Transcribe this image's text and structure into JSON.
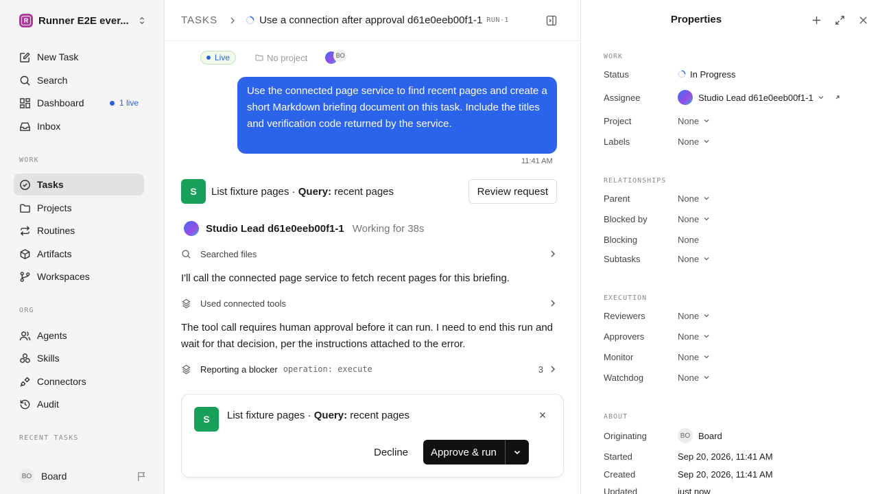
{
  "sidebar": {
    "workspace_name": "Runner E2E ever...",
    "workspace_initial": "R",
    "nav": [
      {
        "label": "New Task",
        "icon": "edit-icon"
      },
      {
        "label": "Search",
        "icon": "search-icon"
      },
      {
        "label": "Dashboard",
        "icon": "dashboard-icon",
        "badge": "1 live"
      },
      {
        "label": "Inbox",
        "icon": "inbox-icon"
      }
    ],
    "work_label": "WORK",
    "work": [
      {
        "label": "Tasks",
        "icon": "check-circle-icon",
        "active": true
      },
      {
        "label": "Projects",
        "icon": "folder-icon"
      },
      {
        "label": "Routines",
        "icon": "repeat-icon"
      },
      {
        "label": "Artifacts",
        "icon": "cube-icon"
      },
      {
        "label": "Workspaces",
        "icon": "branch-icon"
      }
    ],
    "org_label": "ORG",
    "org": [
      {
        "label": "Agents",
        "icon": "users-icon"
      },
      {
        "label": "Skills",
        "icon": "skills-icon"
      },
      {
        "label": "Connectors",
        "icon": "plug-icon"
      },
      {
        "label": "Audit",
        "icon": "history-icon"
      }
    ],
    "recent_label": "RECENT TASKS",
    "footer": {
      "initials": "BO",
      "name": "Board"
    }
  },
  "header": {
    "crumb": "TASKS",
    "title": "Use a connection after approval d61e0eeb00f1-1",
    "run_tag": "RUN-1"
  },
  "meta": {
    "live": "Live",
    "project": "No project",
    "avatar_initials": "BO"
  },
  "message": {
    "text": "Use the connected page service to find recent pages and create a short Markdown briefing document on this task. Include the titles and verification code returned by the service.",
    "time": "11:41 AM"
  },
  "tool_request": {
    "badge": "S",
    "name": "List fixture pages",
    "separator": " · ",
    "query_label": "Query:",
    "query": "recent pages",
    "review_label": "Review request"
  },
  "agent": {
    "name": "Studio Lead d61e0eeb00f1-1",
    "status": "Working for 38s"
  },
  "steps": {
    "searched": "Searched files",
    "para1": "I'll call the connected page service to fetch recent pages for this briefing.",
    "used_tools": "Used connected tools",
    "para2": "The tool call requires human approval before it can run. I need to end this run and wait for that decision, per the instructions attached to the error.",
    "blocker": "Reporting a blocker",
    "blocker_code": "operation: execute",
    "blocker_count": "3"
  },
  "approval": {
    "badge": "S",
    "name": "List fixture pages",
    "separator": " · ",
    "query_label": "Query:",
    "query": "recent pages",
    "decline": "Decline",
    "approve": "Approve & run"
  },
  "properties": {
    "title": "Properties",
    "work_label": "WORK",
    "status_key": "Status",
    "status_val": "In Progress",
    "assignee_key": "Assignee",
    "assignee_val": "Studio Lead d61e0eeb00f1-1",
    "project_key": "Project",
    "project_val": "None",
    "labels_key": "Labels",
    "labels_val": "None",
    "rel_label": "RELATIONSHIPS",
    "parent_key": "Parent",
    "parent_val": "None",
    "blockedby_key": "Blocked by",
    "blockedby_val": "None",
    "blocking_key": "Blocking",
    "blocking_val": "None",
    "subtasks_key": "Subtasks",
    "subtasks_val": "None",
    "exec_label": "EXECUTION",
    "reviewers_key": "Reviewers",
    "reviewers_val": "None",
    "approvers_key": "Approvers",
    "approvers_val": "None",
    "monitor_key": "Monitor",
    "monitor_val": "None",
    "watchdog_key": "Watchdog",
    "watchdog_val": "None",
    "about_label": "ABOUT",
    "originating_key": "Originating",
    "originating_initials": "BO",
    "originating_val": "Board",
    "started_key": "Started",
    "started_val": "Sep 20, 2026, 11:41 AM",
    "created_key": "Created",
    "created_val": "Sep 20, 2026, 11:41 AM",
    "updated_key": "Updated",
    "updated_val": "just now"
  },
  "colors": {
    "accent": "#2b63eb",
    "success": "#18a05a",
    "workspace": "#b1399d"
  }
}
